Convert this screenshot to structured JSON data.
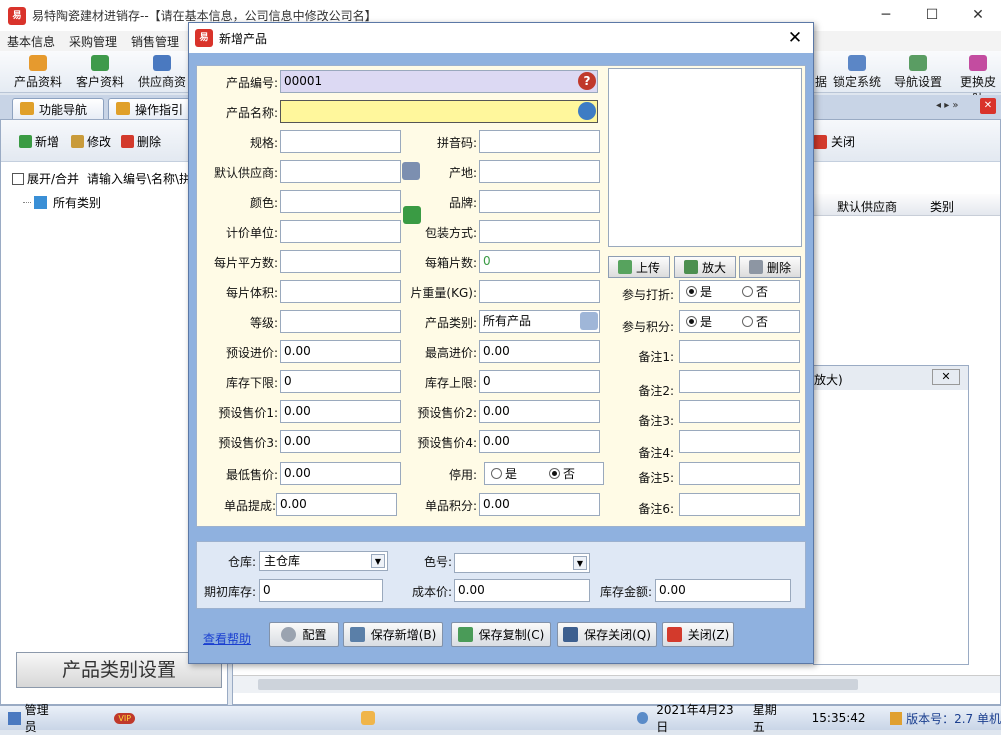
{
  "app": {
    "title": "易特陶瓷建材进销存--【请在基本信息，公司信息中修改公司名】",
    "logo_text": "易"
  },
  "menu": [
    "基本信息",
    "采购管理",
    "销售管理"
  ],
  "toolbar": {
    "left": [
      "产品资料",
      "客户资料",
      "供应商资"
    ],
    "right": [
      "锁定系统",
      "导航设置",
      "更换皮肤"
    ],
    "partial": "据"
  },
  "tabs": [
    "功能导航",
    "操作指引"
  ],
  "left_panel": {
    "buttons": [
      "新增",
      "修改",
      "删除"
    ],
    "expand_label": "展开/合并",
    "search_hint": "请输入编号\\名称\\拼",
    "tree_root": "所有类别",
    "category_button": "产品类别设置"
  },
  "right_panel": {
    "close_button": "关闭",
    "columns": [
      "默认供应商",
      "类别"
    ],
    "sub_window_title": "放大)"
  },
  "statusbar": {
    "user": "管理员",
    "vip": "VIP",
    "date": "2021年4月23日",
    "weekday": "星期五",
    "time": "15:35:42",
    "version": "版本号：2.7 单机"
  },
  "dialog": {
    "title": "新增产品",
    "fields": {
      "code_label": "产品编号:",
      "code_value": "00001",
      "name_label": "产品名称:",
      "name_value": "",
      "spec_label": "规格:",
      "pinyin_label": "拼音码:",
      "supplier_label": "默认供应商:",
      "origin_label": "产地:",
      "color_label": "颜色:",
      "brand_label": "品牌:",
      "unit_label": "计价单位:",
      "package_label": "包装方式:",
      "area_label": "每片平方数:",
      "pieces_label": "每箱片数:",
      "pieces_value": "0",
      "volume_label": "每片体积:",
      "weight_label": "片重量(KG):",
      "grade_label": "等级:",
      "category_label": "产品类别:",
      "category_value": "所有产品",
      "preset_cost_label": "预设进价:",
      "preset_cost_value": "0.00",
      "max_cost_label": "最高进价:",
      "max_cost_value": "0.00",
      "stock_min_label": "库存下限:",
      "stock_min_value": "0",
      "stock_max_label": "库存上限:",
      "stock_max_value": "0",
      "price1_label": "预设售价1:",
      "price1_value": "0.00",
      "price2_label": "预设售价2:",
      "price2_value": "0.00",
      "price3_label": "预设售价3:",
      "price3_value": "0.00",
      "price4_label": "预设售价4:",
      "price4_value": "0.00",
      "min_price_label": "最低售价:",
      "min_price_value": "0.00",
      "disabled_label": "停用:",
      "commission_label": "单品提成:",
      "commission_value": "0.00",
      "points_label": "单品积分:",
      "points_value": "0.00",
      "discount_label": "参与打折:",
      "score_label": "参与积分:",
      "yes": "是",
      "no": "否",
      "notes": [
        "备注1:",
        "备注2:",
        "备注3:",
        "备注4:",
        "备注5:",
        "备注6:"
      ]
    },
    "image_buttons": [
      "上传",
      "放大",
      "删除"
    ],
    "bottom": {
      "warehouse_label": "仓库:",
      "warehouse_value": "主仓库",
      "color_no_label": "色号:",
      "color_no_value": "",
      "init_stock_label": "期初库存:",
      "init_stock_value": "0",
      "cost_label": "成本价:",
      "cost_value": "0.00",
      "stock_amount_label": "库存金额:",
      "stock_amount_value": "0.00"
    },
    "help_link": "查看帮助",
    "buttons": [
      "配置",
      "保存新增(B)",
      "保存复制(C)",
      "保存关闭(Q)",
      "关闭(Z)"
    ]
  },
  "colors": {
    "accent": "#8fb1df",
    "form_bg": "#fffbe6",
    "name_field": "#fff79c",
    "code_field": "#dcd9f3",
    "brand_red": "#d9332b"
  }
}
